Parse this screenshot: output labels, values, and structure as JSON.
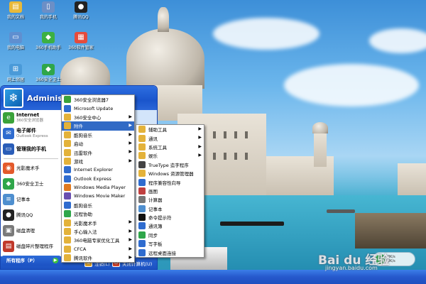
{
  "desktop_icons": [
    {
      "label": "我的文档",
      "icon": "folder-icon",
      "color": "#e8b93a"
    },
    {
      "label": "我的电脑",
      "icon": "computer-icon",
      "color": "#5f8fd0"
    },
    {
      "label": "网上邻居",
      "icon": "network-icon",
      "color": "#4a9ad8"
    },
    {
      "label": "我的手机",
      "icon": "phone-icon",
      "color": "#6c8fc6"
    },
    {
      "label": "腾讯QQ",
      "icon": "qq-penguin-icon",
      "color": "#222222"
    },
    {
      "label": "360手机助手",
      "icon": "shield-icon",
      "color": "#3cb043"
    },
    {
      "label": "360软件管家",
      "icon": "app-grid-icon",
      "color": "#e64b3c"
    },
    {
      "label": "360安全卫士",
      "icon": "shield-icon",
      "color": "#2fa64a"
    }
  ],
  "start_menu": {
    "user": "Administ",
    "left": [
      {
        "title": "Internet",
        "sub": "360安全浏览器",
        "icon": "browser-icon",
        "color": "#3aa23a"
      },
      {
        "title": "电子邮件",
        "sub": "Outlook Express",
        "icon": "mail-icon",
        "color": "#2f6ccf"
      },
      {
        "title": "管理我的手机",
        "sub": "",
        "icon": "phone-manager-icon",
        "color": "#2a5db8"
      },
      {
        "title": "光影魔术手",
        "sub": "",
        "icon": "camera-icon",
        "color": "#e35a2c"
      },
      {
        "title": "360安全卫士",
        "sub": "",
        "icon": "shield-icon",
        "color": "#2fa64a"
      },
      {
        "title": "记事本",
        "sub": "",
        "icon": "notepad-icon",
        "color": "#4f8fcf"
      },
      {
        "title": "腾讯QQ",
        "sub": "",
        "icon": "qq-penguin-icon",
        "color": "#222222"
      },
      {
        "title": "磁盘清理",
        "sub": "",
        "icon": "disk-cleanup-icon",
        "color": "#7a7a7a"
      },
      {
        "title": "磁盘碎片整理程序",
        "sub": "",
        "icon": "defrag-icon",
        "color": "#c0392b"
      }
    ],
    "all_programs": "所有程序（P）",
    "logoff": "注销(L)",
    "shutdown": "关闭计算机(U)"
  },
  "menu_programs": [
    {
      "label": "360安全浏览器7",
      "color": "#3aa23a",
      "arrow": false
    },
    {
      "label": "Microsoft Update",
      "color": "#2f6ccf",
      "arrow": false
    },
    {
      "label": "360安全中心",
      "color": "#e3b23a",
      "arrow": true
    },
    {
      "label": "附件",
      "color": "#e3b23a",
      "arrow": true,
      "highlight": true
    },
    {
      "label": "酷狗音乐",
      "color": "#e3b23a",
      "arrow": true
    },
    {
      "label": "启动",
      "color": "#e3b23a",
      "arrow": true
    },
    {
      "label": "迅雷软件",
      "color": "#e3b23a",
      "arrow": true
    },
    {
      "label": "游戏",
      "color": "#e3b23a",
      "arrow": true
    },
    {
      "label": "Internet Explorer",
      "color": "#2f6ccf",
      "arrow": false
    },
    {
      "label": "Outlook Express",
      "color": "#2f6ccf",
      "arrow": false
    },
    {
      "label": "Windows Media Player",
      "color": "#e07a20",
      "arrow": false
    },
    {
      "label": "Windows Movie Maker",
      "color": "#6a4fb0",
      "arrow": false
    },
    {
      "label": "酷狗音乐",
      "color": "#2f6ccf",
      "arrow": false
    },
    {
      "label": "远程协助",
      "color": "#2fa64a",
      "arrow": false
    },
    {
      "label": "光影魔术手",
      "color": "#e3b23a",
      "arrow": true
    },
    {
      "label": "手心输入法",
      "color": "#e3b23a",
      "arrow": true
    },
    {
      "label": "360电脑专家优化工具",
      "color": "#e3b23a",
      "arrow": true
    },
    {
      "label": "CFCA",
      "color": "#e3b23a",
      "arrow": true
    },
    {
      "label": "腾讯软件",
      "color": "#e3b23a",
      "arrow": true
    }
  ],
  "menu_accessories": [
    {
      "label": "辅助工具",
      "color": "#e3b23a",
      "arrow": true
    },
    {
      "label": "通讯",
      "color": "#e3b23a",
      "arrow": true
    },
    {
      "label": "系统工具",
      "color": "#e3b23a",
      "arrow": true
    },
    {
      "label": "娱乐",
      "color": "#e3b23a",
      "arrow": true
    },
    {
      "label": "TrueType 造字程序",
      "color": "#444444",
      "arrow": false
    },
    {
      "label": "Windows 资源管理器",
      "color": "#e3b23a",
      "arrow": false
    },
    {
      "label": "程序兼容性向导",
      "color": "#2f6ccf",
      "arrow": false
    },
    {
      "label": "画图",
      "color": "#c04040",
      "arrow": false
    },
    {
      "label": "计算器",
      "color": "#777777",
      "arrow": false
    },
    {
      "label": "记事本",
      "color": "#4f8fcf",
      "arrow": false
    },
    {
      "label": "命令提示符",
      "color": "#111111",
      "arrow": false
    },
    {
      "label": "通讯簿",
      "color": "#2f6ccf",
      "arrow": false
    },
    {
      "label": "同步",
      "color": "#2fa64a",
      "arrow": false
    },
    {
      "label": "写字板",
      "color": "#2f6ccf",
      "arrow": false
    },
    {
      "label": "远程桌面连接",
      "color": "#2f6ccf",
      "arrow": false
    }
  ],
  "watermark": {
    "brand": "Bai du 经验",
    "url": "jingyan.baidu.com"
  },
  "tray": {
    "up": "0K/s",
    "down": "0K/s"
  }
}
